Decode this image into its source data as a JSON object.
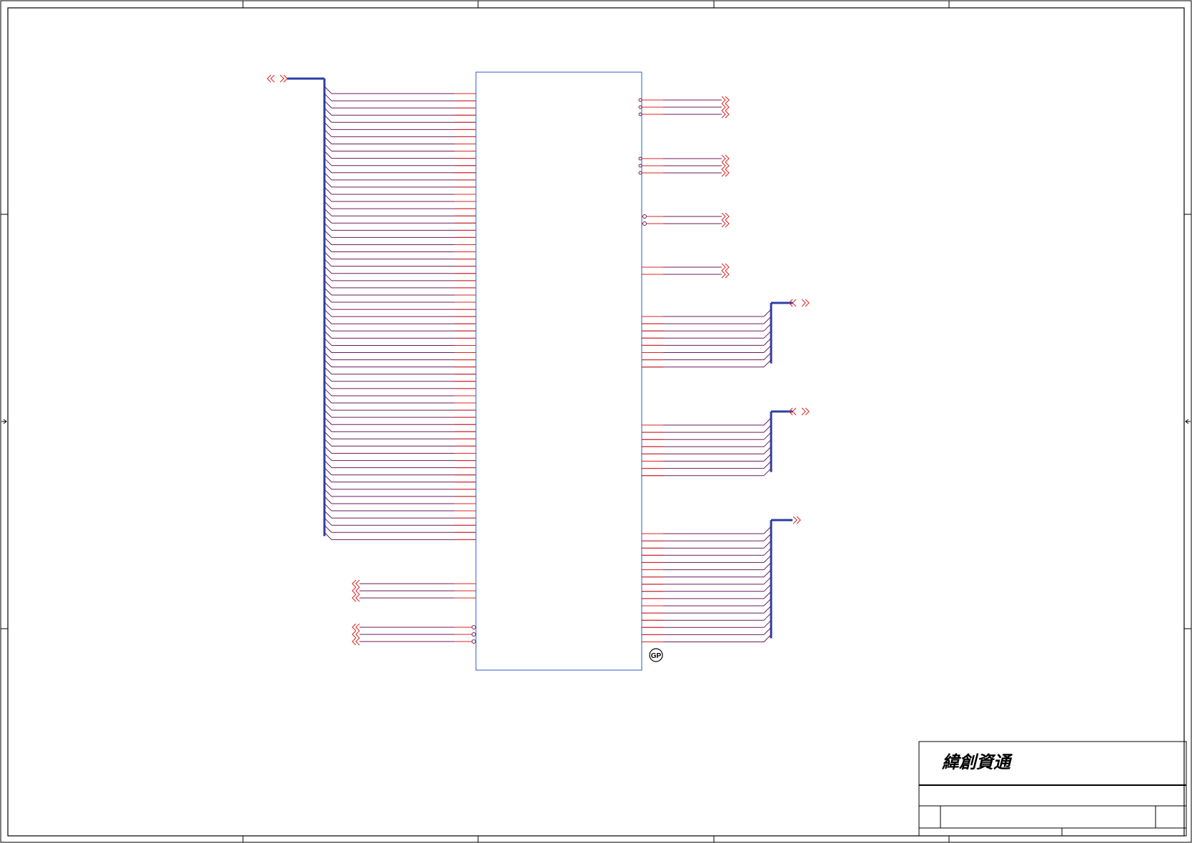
{
  "title_block": {
    "company_logo": "緯創資通"
  },
  "colors": {
    "frame": "#000000",
    "component_outline": "#2b5bc4",
    "bus": "#2c3fa6",
    "net_red": "#e02020",
    "net_purple": "#6a1a5a",
    "port_symbol": "#e02020"
  },
  "schematic": {
    "gp_marker": "GP",
    "left_bus_ports": 1,
    "left_bus_wires": 63,
    "left_single_net_groups": [
      3,
      3
    ],
    "right_single_net_groups": [
      3,
      3,
      2,
      2
    ],
    "right_bus_groups": [
      {
        "wires": 8,
        "port": "bidirectional"
      },
      {
        "wires": 8,
        "port": "bidirectional"
      },
      {
        "wires": 16,
        "port": "output"
      }
    ]
  }
}
